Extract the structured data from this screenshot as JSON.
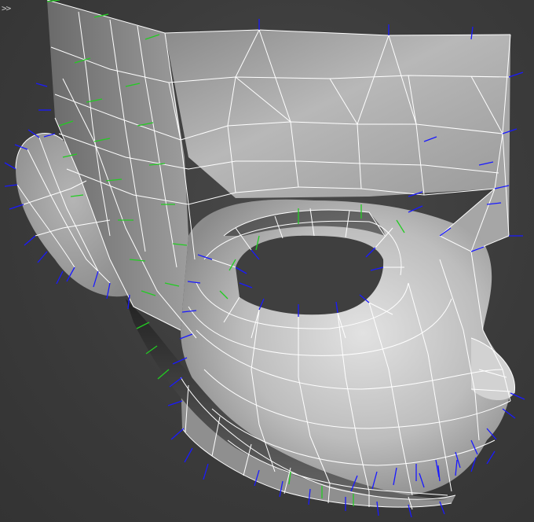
{
  "viewport": {
    "toggle_label": ">>",
    "background_color": "#3d3d3d",
    "mesh_color": "#a9a9a9",
    "wire_color": "#ffffff",
    "vertex_normal_color": "#1a1aff",
    "face_normal_color": "#22cc22"
  }
}
